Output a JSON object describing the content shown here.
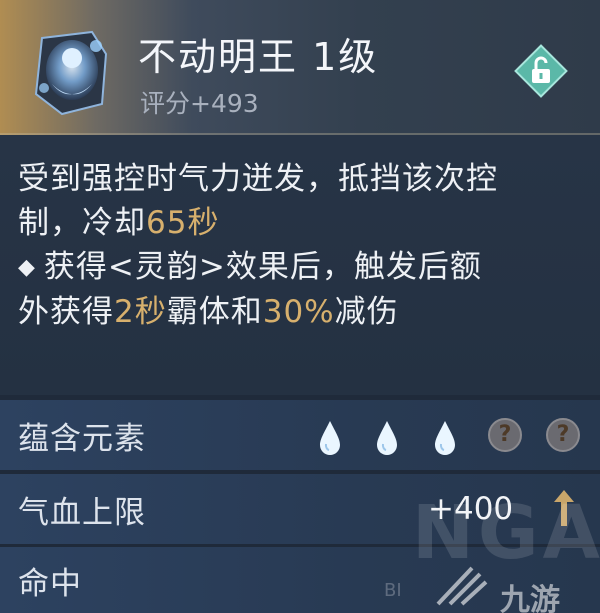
{
  "item": {
    "name": "不动明王 1级",
    "score": "评分+493",
    "lock_icon": "unlock-icon"
  },
  "description": {
    "line1": "受到强控时气力迸发，抵挡该次控",
    "line2_pre": "制，冷却",
    "line2_hl": "65秒",
    "bullet": "◆",
    "line3": "获得<灵韵>效果后，触发后额",
    "line4_pre": "外获得",
    "line4_hl1": "2秒",
    "line4_mid": "霸体和",
    "line4_hl2": "30%",
    "line4_post": "减伤"
  },
  "stats": {
    "elements_label": "蕴含元素",
    "hp_label": "气血上限",
    "hp_value": "+400",
    "hit_label": "命中",
    "element_slots": [
      "water-drop-icon",
      "water-drop-icon",
      "water-drop-icon",
      "unknown-icon",
      "unknown-icon"
    ],
    "unknown_glyph": "?"
  },
  "watermark": {
    "main": "NGA",
    "brand": "九游",
    "small": "BI"
  },
  "colors": {
    "highlight": "#d7b06d",
    "row_bg": "#2d4260",
    "desc_bg": "#273446"
  }
}
